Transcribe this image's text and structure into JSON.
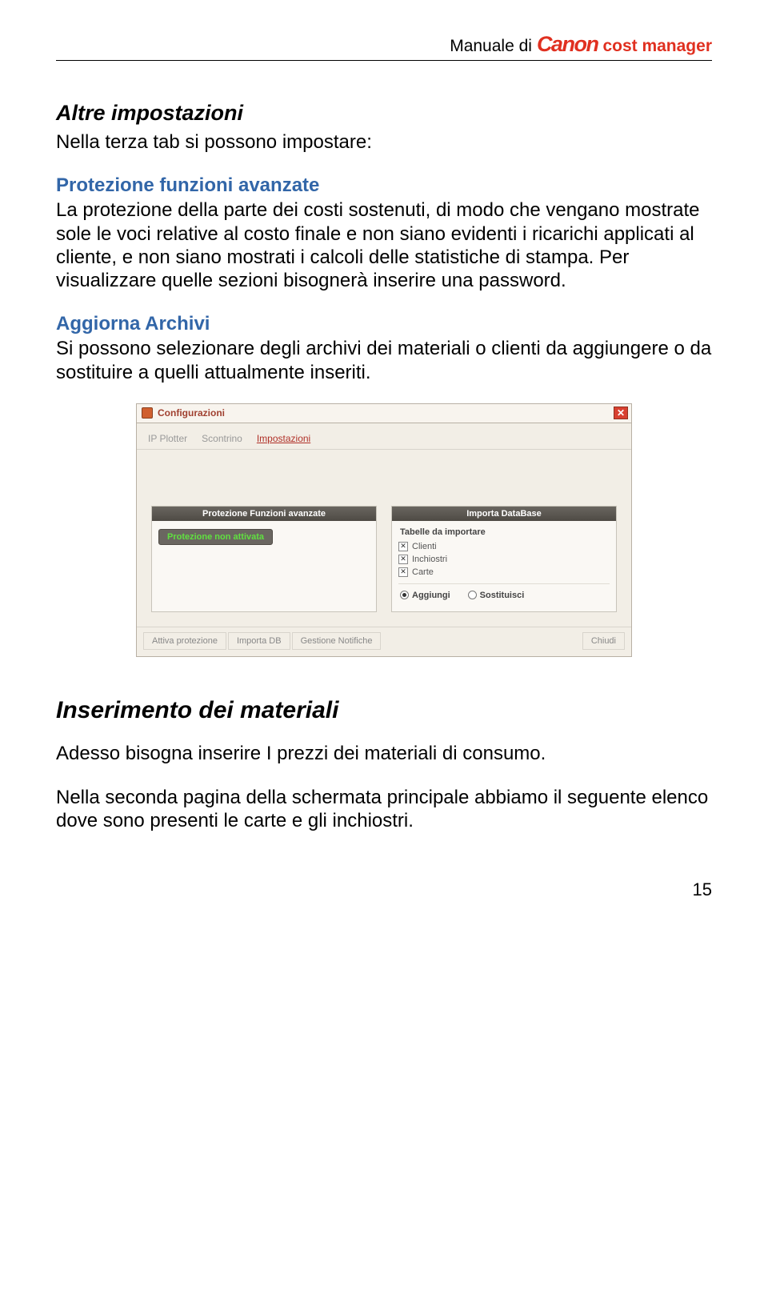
{
  "header": {
    "prefix": "Manuale di",
    "brand": "Canon",
    "product": "cost manager"
  },
  "sections": {
    "altre": {
      "title": "Altre impostazioni",
      "intro": "Nella terza tab si possono impostare:",
      "protezione": {
        "title": "Protezione funzioni avanzate",
        "body": "La protezione della parte dei costi sostenuti, di modo che vengano mostrate sole le voci relative al costo finale e non siano evidenti i ricarichi applicati al cliente, e non siano mostrati i calcoli delle statistiche di stampa. Per visualizzare quelle sezioni bisognerà inserire una password."
      },
      "aggiorna": {
        "title": "Aggiorna Archivi",
        "body": "Si possono selezionare degli archivi dei materiali o clienti da aggiungere o da sostituire a quelli attualmente inseriti."
      }
    },
    "inserimento": {
      "title": "Inserimento dei materiali",
      "p1": "Adesso bisogna inserire I prezzi dei materiali di consumo.",
      "p2": "Nella seconda pagina della schermata principale abbiamo il seguente elenco dove sono presenti le carte e gli inchiostri."
    }
  },
  "dialog": {
    "title": "Configurazioni",
    "close_label": "✕",
    "tabs": {
      "t1": "IP Plotter",
      "t2": "Scontrino",
      "t3": "Impostazioni"
    },
    "left_panel": {
      "header": "Protezione Funzioni avanzate",
      "pill": "Protezione non attivata"
    },
    "right_panel": {
      "header": "Importa DataBase",
      "sub": "Tabelle da importare",
      "chk1": "Clienti",
      "chk2": "Inchiostri",
      "chk3": "Carte",
      "rad1": "Aggiungi",
      "rad2": "Sostituisci"
    },
    "buttons": {
      "b1": "Attiva protezione",
      "b2": "Importa DB",
      "b3": "Gestione Notifiche",
      "b4": "Chiudi"
    }
  },
  "page_number": "15"
}
